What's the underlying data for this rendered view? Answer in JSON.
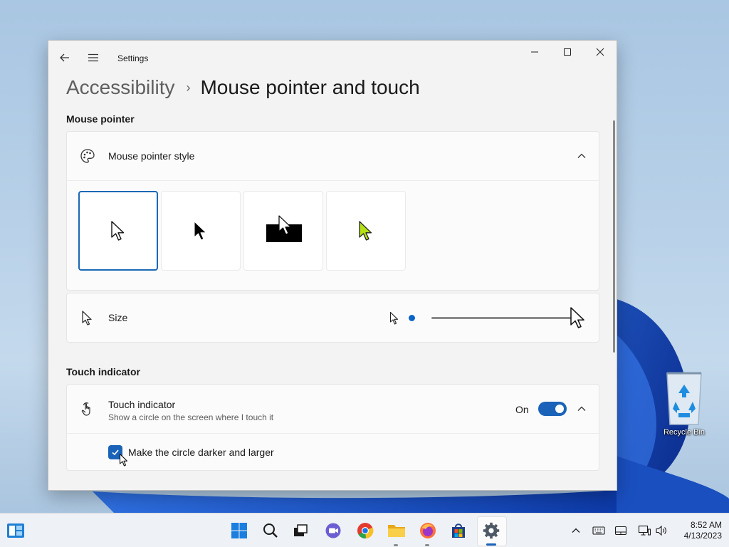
{
  "window": {
    "app_title": "Settings",
    "breadcrumb_parent": "Accessibility",
    "breadcrumb_current": "Mouse pointer and touch"
  },
  "mouse_pointer": {
    "section_title": "Mouse pointer",
    "style_label": "Mouse pointer style",
    "style_options": [
      {
        "name": "white",
        "selected": true
      },
      {
        "name": "black",
        "selected": false
      },
      {
        "name": "inverted",
        "selected": false
      },
      {
        "name": "custom",
        "color": "#b4e014",
        "selected": false
      }
    ],
    "size_label": "Size",
    "size_value": 1
  },
  "touch": {
    "section_title": "Touch indicator",
    "label": "Touch indicator",
    "description": "Show a circle on the screen where I touch it",
    "toggle_state": "On",
    "checkbox_label": "Make the circle darker and larger",
    "checkbox_checked": true
  },
  "desktop": {
    "recycle_bin_label": "Recycle Bin"
  },
  "taskbar": {
    "time": "8:52 AM",
    "date": "4/13/2023",
    "apps": [
      "start-icon",
      "search-icon",
      "task-view-icon",
      "teams-chat-icon",
      "chrome-icon",
      "file-explorer-icon",
      "firefox-icon",
      "store-icon",
      "settings-icon"
    ],
    "tray": [
      "chevron-up-icon",
      "keyboard-icon",
      "touchpad-icon",
      "network-icon",
      "volume-icon"
    ]
  },
  "colors": {
    "accent": "#1a63b8",
    "window_bg": "#f3f3f3",
    "card_bg": "#fbfbfb"
  }
}
